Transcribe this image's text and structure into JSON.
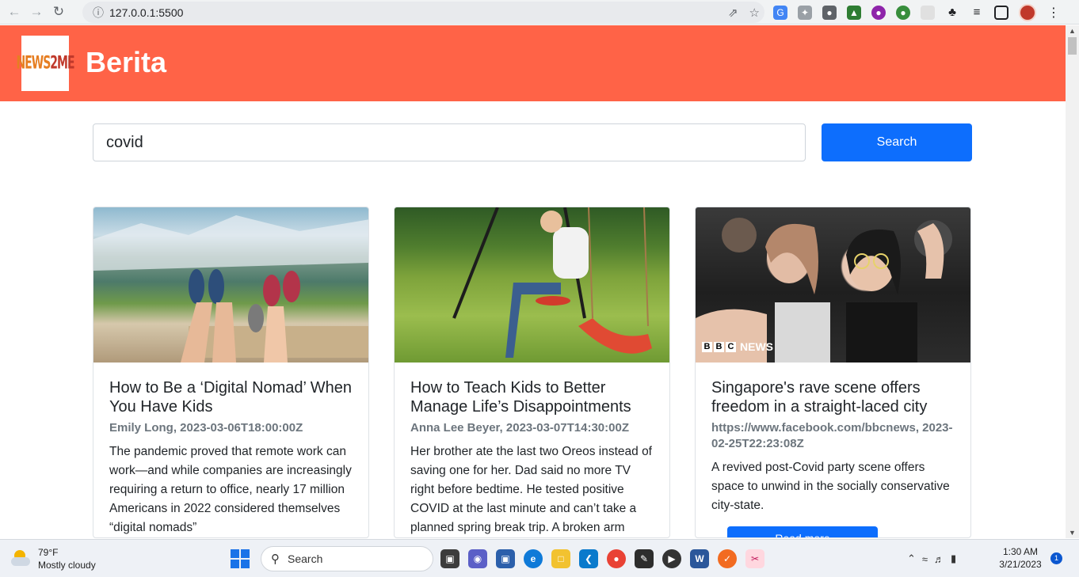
{
  "browser": {
    "url": "127.0.0.1:5500"
  },
  "header": {
    "logo_text_a": "NEWS",
    "logo_text_b": "2",
    "logo_text_c": "ME",
    "title": "Berita"
  },
  "search": {
    "value": "covid",
    "button_label": "Search"
  },
  "articles": [
    {
      "title": "How to Be a ‘Digital Nomad’ When You Have Kids",
      "meta": "Emily Long, 2023-03-06T18:00:00Z",
      "description": "The pandemic proved that remote work can work—and while companies are increasingly requiring a return to office, nearly 17 million Americans in 2022 considered themselves “digital nomads”"
    },
    {
      "title": "How to Teach Kids to Better Manage Life’s Disappointments",
      "meta": "Anna Lee Beyer, 2023-03-07T14:30:00Z",
      "description": "Her brother ate the last two Oreos instead of saving one for her. Dad said no more TV right before bedtime. He tested positive COVID at the last minute and can’t take a planned spring break trip. A broken arm"
    },
    {
      "title": "Singapore's rave scene offers freedom in a straight-laced city",
      "meta": "https://www.facebook.com/bbcnews, 2023-02-25T22:23:08Z",
      "description": "A revived post-Covid party scene offers space to unwind in the socially conservative city-state.",
      "image_badge": "NEWS",
      "read_more": "Read more"
    }
  ],
  "taskbar": {
    "weather_temp": "79°F",
    "weather_desc": "Mostly cloudy",
    "search_label": "Search",
    "time": "1:30 AM",
    "date": "3/21/2023",
    "notification_count": "1"
  },
  "colors": {
    "header_bg": "#ff6347",
    "primary_button": "#0d6efd"
  }
}
